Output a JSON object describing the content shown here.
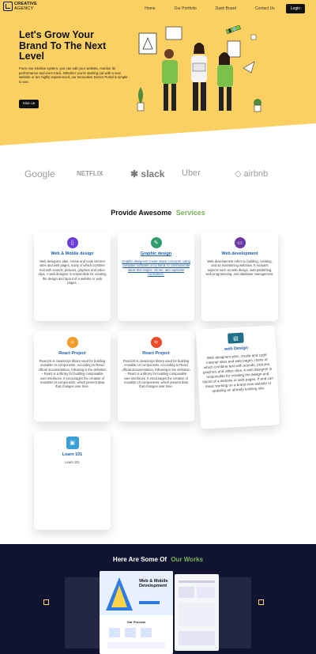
{
  "brand": {
    "line1": "CREATIVE",
    "line2": "AGENCY"
  },
  "nav": {
    "items": [
      "Home",
      "Our Portfolio",
      "Dash Board",
      "Contact Us"
    ],
    "login": "Login"
  },
  "hero": {
    "title": "Let's Grow Your Brand To The Next Level",
    "description": "From one intuitive system, you can edit your website, monitor its performance and even track. Whether you're starting out with a new website or are highly experienced, our Innovative Doctor Portal is simple to use.",
    "button": "Hire us"
  },
  "brands": [
    "Google",
    "NETFLIX",
    "slack",
    "Uber",
    "airbnb"
  ],
  "services": {
    "title_part1": "Provide Awesome",
    "title_part2": "Services",
    "cards": [
      {
        "title": "Web & Mobile design",
        "desc": "Web designers plan, create and code internet sites and web pages, many of which combine text with sounds, pictures, graphics and video clips. A web designer is responsible for creating the design and layout of a website or web pages.",
        "icon": "mobile-icon",
        "color": "#6c3ce0"
      },
      {
        "title": "Graphic design",
        "desc": "Graphic designers create visual concepts, using computer software or by hand, to communicate ideas that inspire, inform, and captivate consumers.",
        "icon": "graphic-icon",
        "color": "#2f9e6e"
      },
      {
        "title": "Web development",
        "desc": "Web development refers to building, creating, and an maintaining websites. It includes aspects such as web design, web publishing, web programming, and database management.",
        "icon": "monitor-icon",
        "color": "#6b3aa8"
      },
      {
        "title": "React Project",
        "desc": "ReactJS is JavaScript library used for building reusable UI components. According to React official documentation, following is the definition – React is a library for building composable user interfaces. It encourages the creation of reusable UI components, which present data that changes over time.",
        "icon": "react-icon",
        "color": "#f29b27"
      },
      {
        "title": "React Project",
        "desc": "ReactJS is JavaScript library used for building reusable UI components. According to React official documentation, following is the definition – React is a library for building composable user interfaces. It encourages the creation of reusable UI components, which present data that changes over time.",
        "icon": "react-icon",
        "color": "#e94b2a"
      },
      {
        "title": "web Design",
        "desc": "Web designers plan, create and code internet sites and web pages, many of which combine text with sounds, pictures, graphics and video clips. A web designer is responsible for creating the design and layout of a website or web pages. It and can mean working on a brand new website or updating an already existing site.",
        "icon": "laptop-icon",
        "color": "#1f6f8b"
      },
      {
        "title": "Learn 101",
        "desc": "Learn 101",
        "icon": "learn-icon",
        "color": "#3aa0d8"
      }
    ]
  },
  "works": {
    "title_part1": "Here Are Some Of",
    "title_part2": "Our Works",
    "slide_title": "Web & Mobile Development",
    "slide_subtitle": "Our Process"
  },
  "colors": {
    "hero_bg": "#fbd062",
    "accent_green": "#7ab259",
    "works_bg": "#111430",
    "link_blue": "#1e5ea8"
  }
}
